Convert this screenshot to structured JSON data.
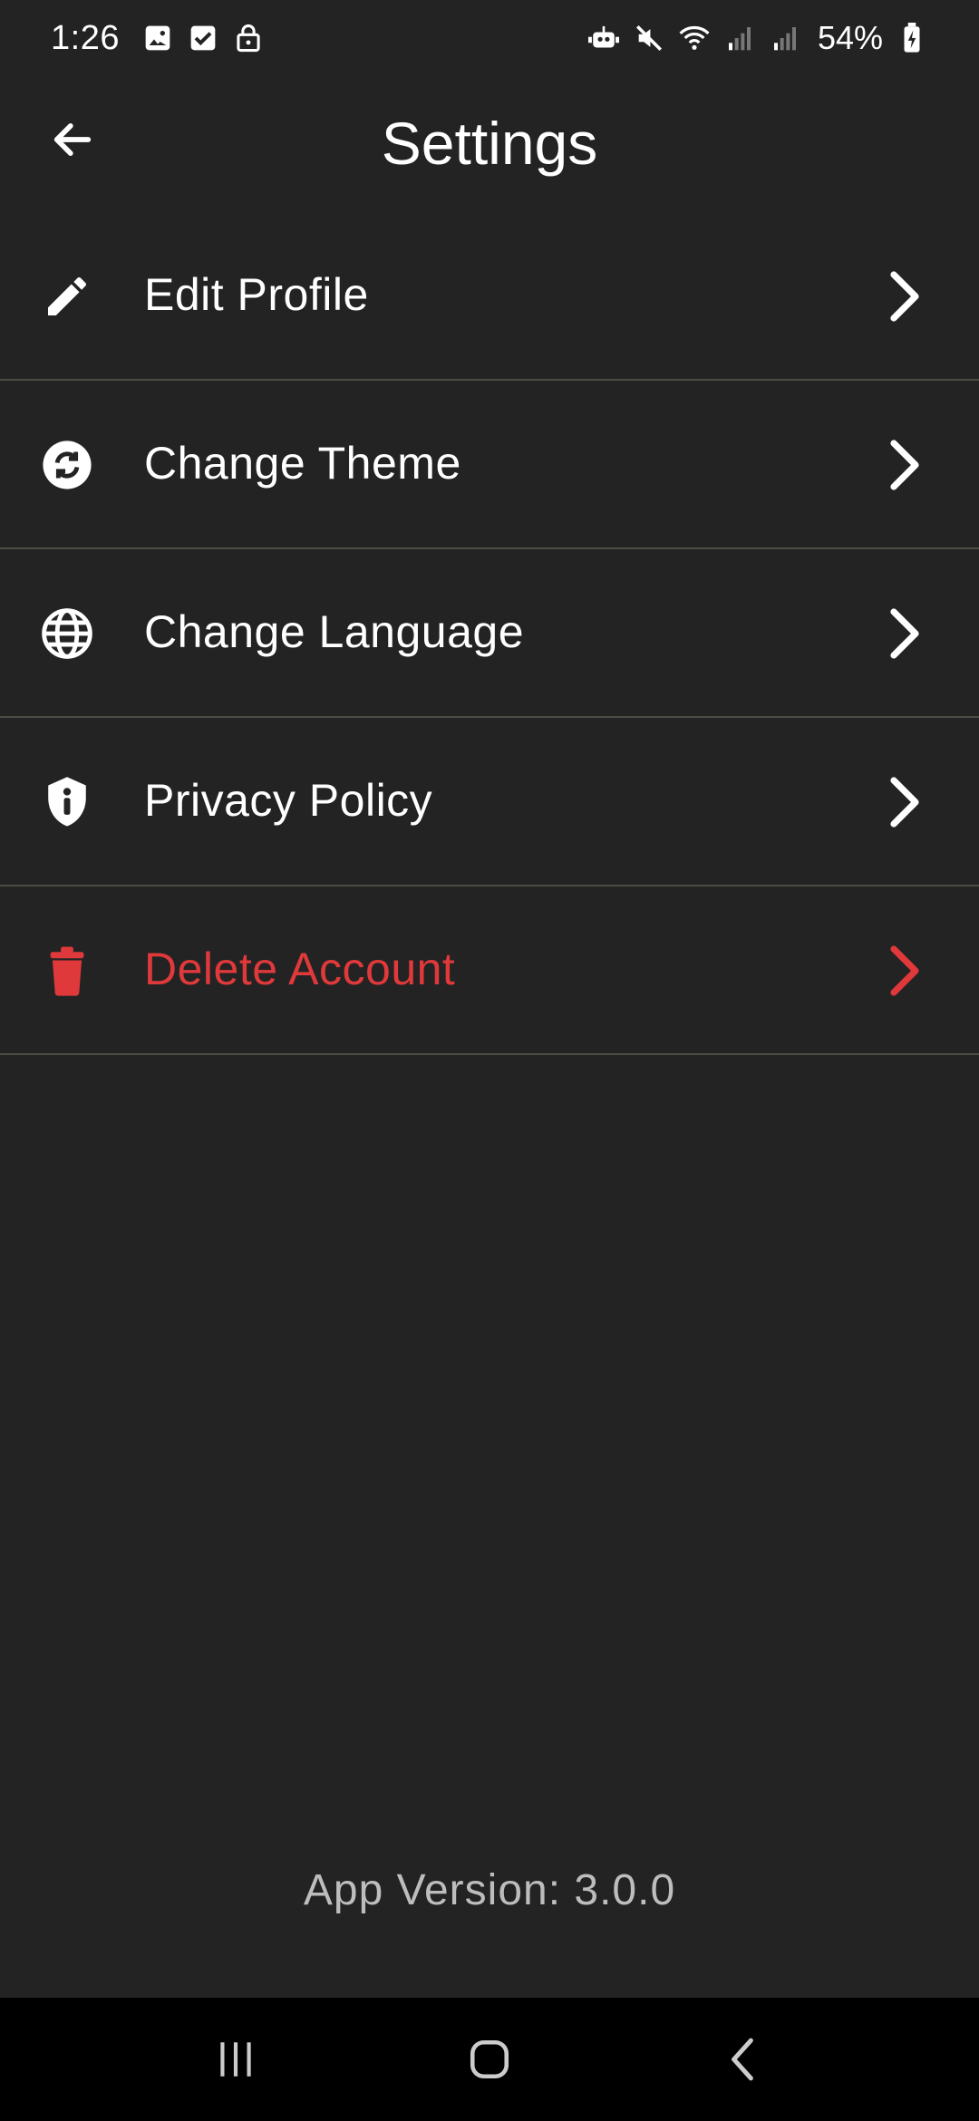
{
  "status_bar": {
    "time": "1:26",
    "battery": "54%"
  },
  "header": {
    "title": "Settings"
  },
  "settings": {
    "items": [
      {
        "label": "Edit Profile",
        "icon": "pencil-icon"
      },
      {
        "label": "Change Theme",
        "icon": "theme-sync-icon"
      },
      {
        "label": "Change Language",
        "icon": "globe-icon"
      },
      {
        "label": "Privacy Policy",
        "icon": "shield-info-icon"
      },
      {
        "label": "Delete Account",
        "icon": "trash-icon"
      }
    ]
  },
  "footer": {
    "version": "App Version: 3.0.0"
  },
  "colors": {
    "background": "#232323",
    "divider": "#4d4d45",
    "danger": "#e0393b",
    "text": "#ffffff",
    "muted": "#bdbdbd"
  }
}
